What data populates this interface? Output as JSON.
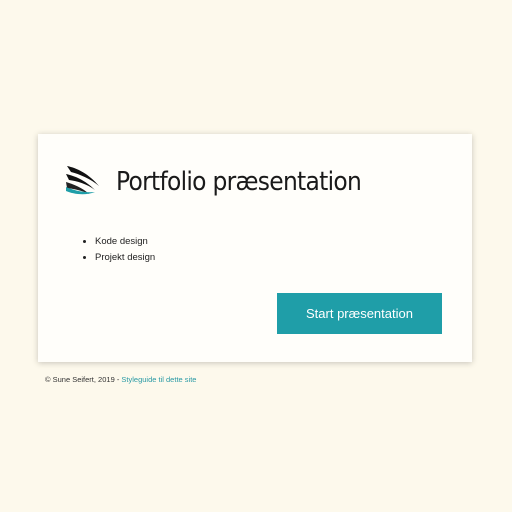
{
  "card": {
    "logo_icon": "feather-wings-icon",
    "title": "Portfolio præsentation",
    "topics": [
      "Kode design",
      "Projekt design"
    ],
    "start_button_label": "Start præsentation"
  },
  "footer": {
    "copyright": "© Sune Seifert, 2019 - ",
    "styleguide_link": "Styleguide til dette site"
  },
  "colors": {
    "page_background": "#fdf9ec",
    "card_background": "#fffefa",
    "accent": "#1f9ea8",
    "link": "#2a9aa5"
  }
}
